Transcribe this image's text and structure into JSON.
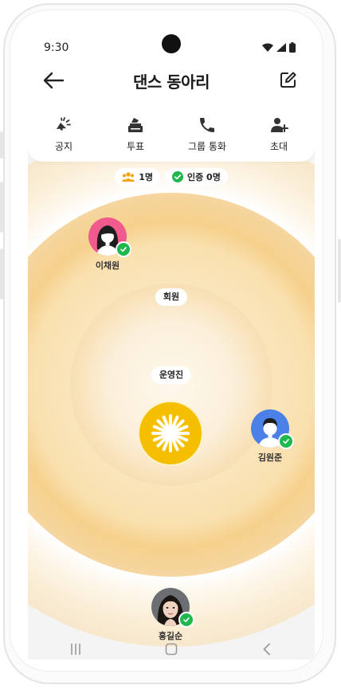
{
  "status_bar": {
    "time": "9:30",
    "icons": [
      "wifi-icon",
      "signal-icon",
      "battery-icon"
    ]
  },
  "header": {
    "title": "댄스 동아리",
    "back_icon": "arrow-left-icon",
    "edit_icon": "edit-icon"
  },
  "actions": [
    {
      "label": "공지",
      "icon": "megaphone-icon"
    },
    {
      "label": "투표",
      "icon": "ballot-box-icon"
    },
    {
      "label": "그룹 통화",
      "icon": "phone-icon"
    },
    {
      "label": "초대",
      "icon": "add-user-icon"
    }
  ],
  "counts": {
    "members": "1명",
    "verified": "인증 0명"
  },
  "zones": {
    "outer": "회원",
    "inner": "운영진"
  },
  "members": [
    {
      "name": "이채원",
      "verified": true
    },
    {
      "name": "김원준",
      "verified": true
    },
    {
      "name": "홍길순",
      "verified": true
    }
  ],
  "colors": {
    "accent": "#F5BF00",
    "ring": "#F6D18D",
    "verified": "#21B74F"
  },
  "nav": [
    "recent-apps-icon",
    "home-icon",
    "back-icon"
  ]
}
